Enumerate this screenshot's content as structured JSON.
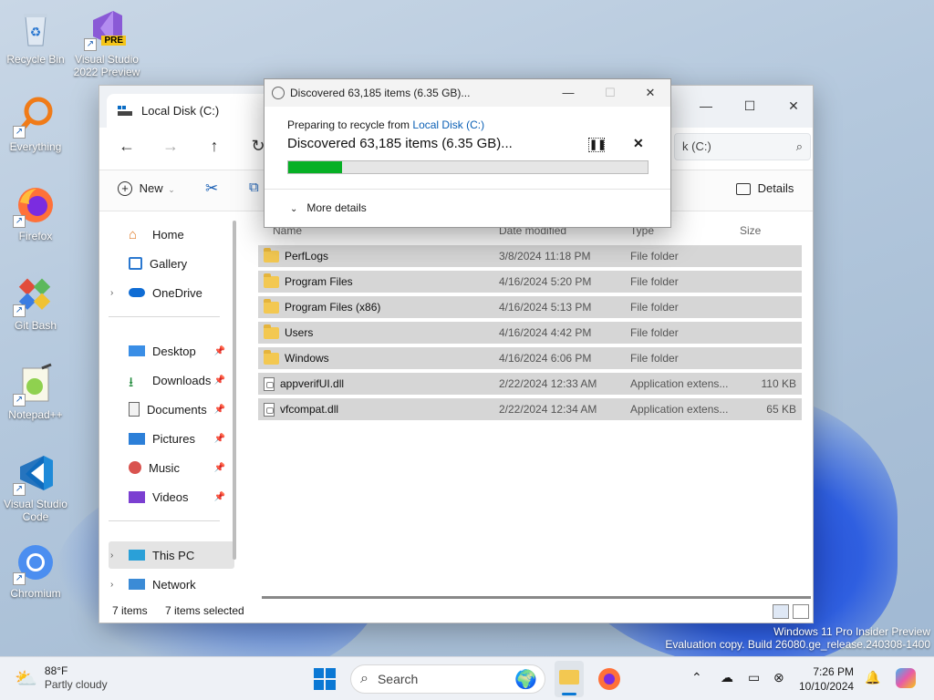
{
  "desktop": {
    "icons": [
      {
        "label": "Recycle Bin",
        "icon": "recycle-bin-icon"
      },
      {
        "label": "Visual Studio 2022 Preview",
        "line1": "Visual Studio",
        "line2": "2022 Preview",
        "badge": "PRE",
        "icon": "visual-studio-icon"
      },
      {
        "label": "Everything",
        "icon": "everything-search-icon"
      },
      {
        "label": "Firefox",
        "icon": "firefox-icon"
      },
      {
        "label": "Git Bash",
        "icon": "git-bash-icon"
      },
      {
        "label": "Notepad++",
        "icon": "notepad-plus-plus-icon"
      },
      {
        "label": "Visual Studio Code",
        "line1": "Visual Studio",
        "line2": "Code",
        "icon": "vscode-icon"
      },
      {
        "label": "Chromium",
        "icon": "chromium-icon"
      }
    ],
    "watermark_line1": "Windows 11 Pro Insider Preview",
    "watermark_line2": "Evaluation copy. Build 26080.ge_release.240308-1400"
  },
  "explorer": {
    "tab_title": "Local Disk (C:)",
    "address_text": "k (C:)",
    "toolbar": {
      "new_label": "New",
      "details_label": "Details"
    },
    "sidebar": {
      "items": [
        {
          "label": "Home",
          "icon": "home-icon"
        },
        {
          "label": "Gallery",
          "icon": "gallery-icon"
        },
        {
          "label": "OneDrive",
          "icon": "onedrive-icon"
        },
        {
          "label": "Desktop",
          "icon": "desktop-folder-icon"
        },
        {
          "label": "Downloads",
          "icon": "downloads-icon"
        },
        {
          "label": "Documents",
          "icon": "documents-icon"
        },
        {
          "label": "Pictures",
          "icon": "pictures-icon"
        },
        {
          "label": "Music",
          "icon": "music-icon"
        },
        {
          "label": "Videos",
          "icon": "videos-icon"
        },
        {
          "label": "This PC",
          "icon": "this-pc-icon"
        },
        {
          "label": "Network",
          "icon": "network-icon"
        }
      ]
    },
    "columns": {
      "name": "Name",
      "date": "Date modified",
      "type": "Type",
      "size": "Size"
    },
    "rows": [
      {
        "name": "PerfLogs",
        "date": "3/8/2024 11:18 PM",
        "type": "File folder",
        "size": "",
        "kind": "folder"
      },
      {
        "name": "Program Files",
        "date": "4/16/2024 5:20 PM",
        "type": "File folder",
        "size": "",
        "kind": "folder"
      },
      {
        "name": "Program Files (x86)",
        "date": "4/16/2024 5:13 PM",
        "type": "File folder",
        "size": "",
        "kind": "folder"
      },
      {
        "name": "Users",
        "date": "4/16/2024 4:42 PM",
        "type": "File folder",
        "size": "",
        "kind": "folder"
      },
      {
        "name": "Windows",
        "date": "4/16/2024 6:06 PM",
        "type": "File folder",
        "size": "",
        "kind": "folder"
      },
      {
        "name": "appverifUI.dll",
        "date": "2/22/2024 12:33 AM",
        "type": "Application extens...",
        "size": "110 KB",
        "kind": "file"
      },
      {
        "name": "vfcompat.dll",
        "date": "2/22/2024 12:34 AM",
        "type": "Application extens...",
        "size": "65 KB",
        "kind": "file"
      }
    ],
    "status": {
      "count": "7 items",
      "selected": "7 items selected"
    }
  },
  "dialog": {
    "title": "Discovered 63,185 items (6.35 GB)...",
    "preparing_prefix": "Preparing to recycle from ",
    "preparing_link": "Local Disk (C:)",
    "heading": "Discovered 63,185 items (6.35 GB)...",
    "progress_fraction": 0.15,
    "more_details": "More details",
    "accent": "#06b025"
  },
  "taskbar": {
    "weather_temp": "88°F",
    "weather_desc": "Partly cloudy",
    "search_placeholder": "Search",
    "time": "7:26 PM",
    "date": "10/10/2024"
  }
}
